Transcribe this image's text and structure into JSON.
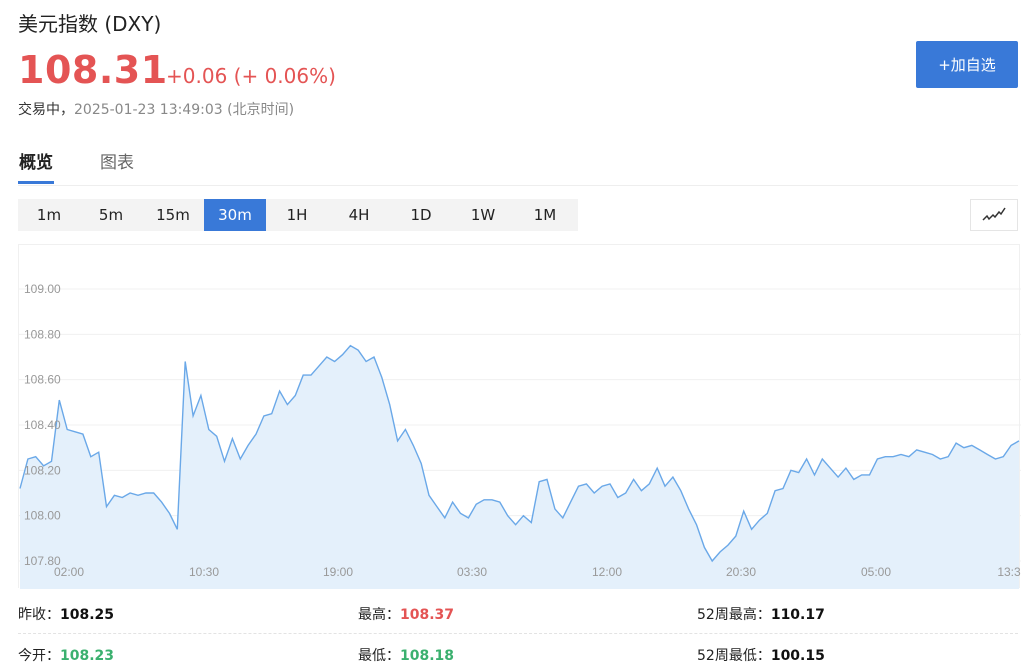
{
  "header": {
    "title": "美元指数 (DXY)",
    "price": "108.31",
    "change": "+0.06 (+ 0.06%)",
    "status": "交易中，",
    "timestamp": "2025-01-23 13:49:03 (北京时间)",
    "add_button": "+加自选"
  },
  "tabs": [
    "概览",
    "图表"
  ],
  "ranges": [
    "1m",
    "5m",
    "15m",
    "30m",
    "1H",
    "4H",
    "1D",
    "1W",
    "1M"
  ],
  "active_range": "30m",
  "chart_type_icon": "line-chart-icon",
  "colors": {
    "up": "#e45454",
    "down": "#3bb06f",
    "accent": "#3979d8",
    "line": "#6aa8e8",
    "fill": "#e4f0fb"
  },
  "chart_data": {
    "type": "area",
    "ylim": [
      107.8,
      109.0
    ],
    "yticks": [
      "109.00",
      "108.80",
      "108.60",
      "108.40",
      "108.20",
      "108.00",
      "107.80"
    ],
    "xticks": [
      "02:00",
      "10:30",
      "19:00",
      "03:30",
      "12:00",
      "20:30",
      "05:00",
      "13:3"
    ],
    "values": [
      108.12,
      108.25,
      108.26,
      108.22,
      108.24,
      108.51,
      108.38,
      108.37,
      108.36,
      108.26,
      108.28,
      108.04,
      108.09,
      108.08,
      108.1,
      108.09,
      108.1,
      108.1,
      108.06,
      108.01,
      107.94,
      108.68,
      108.44,
      108.53,
      108.38,
      108.35,
      108.24,
      108.34,
      108.25,
      108.31,
      108.36,
      108.44,
      108.45,
      108.55,
      108.49,
      108.53,
      108.62,
      108.62,
      108.66,
      108.7,
      108.68,
      108.71,
      108.75,
      108.73,
      108.68,
      108.7,
      108.61,
      108.49,
      108.33,
      108.38,
      108.31,
      108.23,
      108.09,
      108.04,
      107.99,
      108.06,
      108.01,
      107.99,
      108.05,
      108.07,
      108.07,
      108.06,
      108.0,
      107.96,
      108.0,
      107.97,
      108.15,
      108.16,
      108.03,
      107.99,
      108.06,
      108.13,
      108.14,
      108.1,
      108.13,
      108.14,
      108.08,
      108.1,
      108.16,
      108.11,
      108.14,
      108.21,
      108.13,
      108.17,
      108.11,
      108.03,
      107.96,
      107.86,
      107.8,
      107.84,
      107.87,
      107.91,
      108.02,
      107.94,
      107.98,
      108.01,
      108.11,
      108.12,
      108.2,
      108.19,
      108.25,
      108.18,
      108.25,
      108.21,
      108.17,
      108.21,
      108.16,
      108.18,
      108.18,
      108.25,
      108.26,
      108.26,
      108.27,
      108.26,
      108.29,
      108.28,
      108.27,
      108.25,
      108.26,
      108.32,
      108.3,
      108.31,
      108.29,
      108.27,
      108.25,
      108.26,
      108.31,
      108.33
    ]
  },
  "stats": {
    "prev_close_label": "昨收：",
    "prev_close": "108.25",
    "high_label": "最高：",
    "high": "108.37",
    "high52_label": "52周最高：",
    "high52": "110.17",
    "open_label": "今开：",
    "open": "108.23",
    "low_label": "最低：",
    "low": "108.18",
    "low52_label": "52周最低：",
    "low52": "100.15"
  }
}
